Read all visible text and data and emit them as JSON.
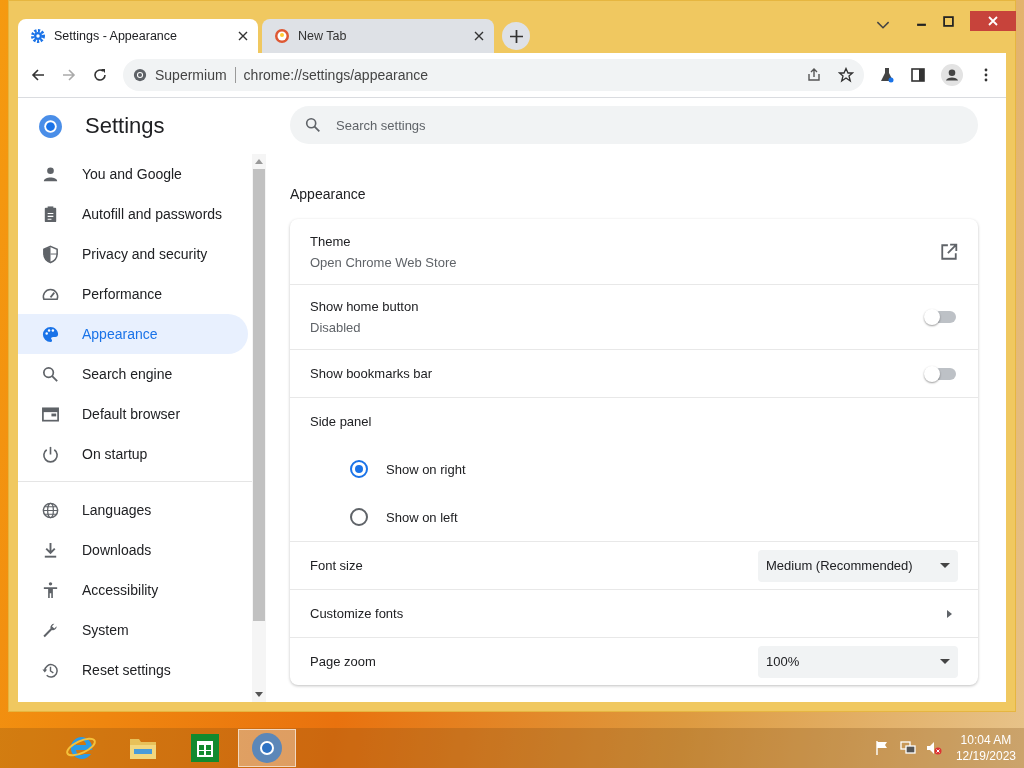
{
  "tabs": [
    {
      "title": "Settings - Appearance",
      "selected": true
    },
    {
      "title": "New Tab",
      "selected": false
    }
  ],
  "toolbar": {
    "site": "Supermium",
    "url": "chrome://settings/appearance"
  },
  "sidebar": {
    "title": "Settings",
    "groups": [
      [
        {
          "label": "You and Google",
          "selected": false
        },
        {
          "label": "Autofill and passwords",
          "selected": false
        },
        {
          "label": "Privacy and security",
          "selected": false
        },
        {
          "label": "Performance",
          "selected": false
        },
        {
          "label": "Appearance",
          "selected": true
        },
        {
          "label": "Search engine",
          "selected": false
        },
        {
          "label": "Default browser",
          "selected": false
        },
        {
          "label": "On startup",
          "selected": false
        }
      ],
      [
        {
          "label": "Languages",
          "selected": false
        },
        {
          "label": "Downloads",
          "selected": false
        },
        {
          "label": "Accessibility",
          "selected": false
        },
        {
          "label": "System",
          "selected": false
        },
        {
          "label": "Reset settings",
          "selected": false
        }
      ]
    ]
  },
  "search": {
    "placeholder": "Search settings"
  },
  "section_title": "Appearance",
  "rows": [
    {
      "kind": "link",
      "title": "Theme",
      "subtitle": "Open Chrome Web Store"
    },
    {
      "kind": "toggle",
      "title": "Show home button",
      "subtitle": "Disabled",
      "on": false
    },
    {
      "kind": "toggle",
      "title": "Show bookmarks bar",
      "on": false
    },
    {
      "kind": "radios",
      "title": "Side panel",
      "options": [
        {
          "label": "Show on right",
          "selected": true
        },
        {
          "label": "Show on left",
          "selected": false
        }
      ]
    },
    {
      "kind": "dropdown",
      "title": "Font size",
      "value": "Medium (Recommended)"
    },
    {
      "kind": "submenu",
      "title": "Customize fonts"
    },
    {
      "kind": "dropdown",
      "title": "Page zoom",
      "value": "100%"
    }
  ],
  "taskbar": {
    "apps": [
      {
        "selected": false
      },
      {
        "selected": false
      },
      {
        "selected": false
      },
      {
        "selected": true
      }
    ],
    "time": "10:04 AM",
    "date": "12/19/2023"
  }
}
